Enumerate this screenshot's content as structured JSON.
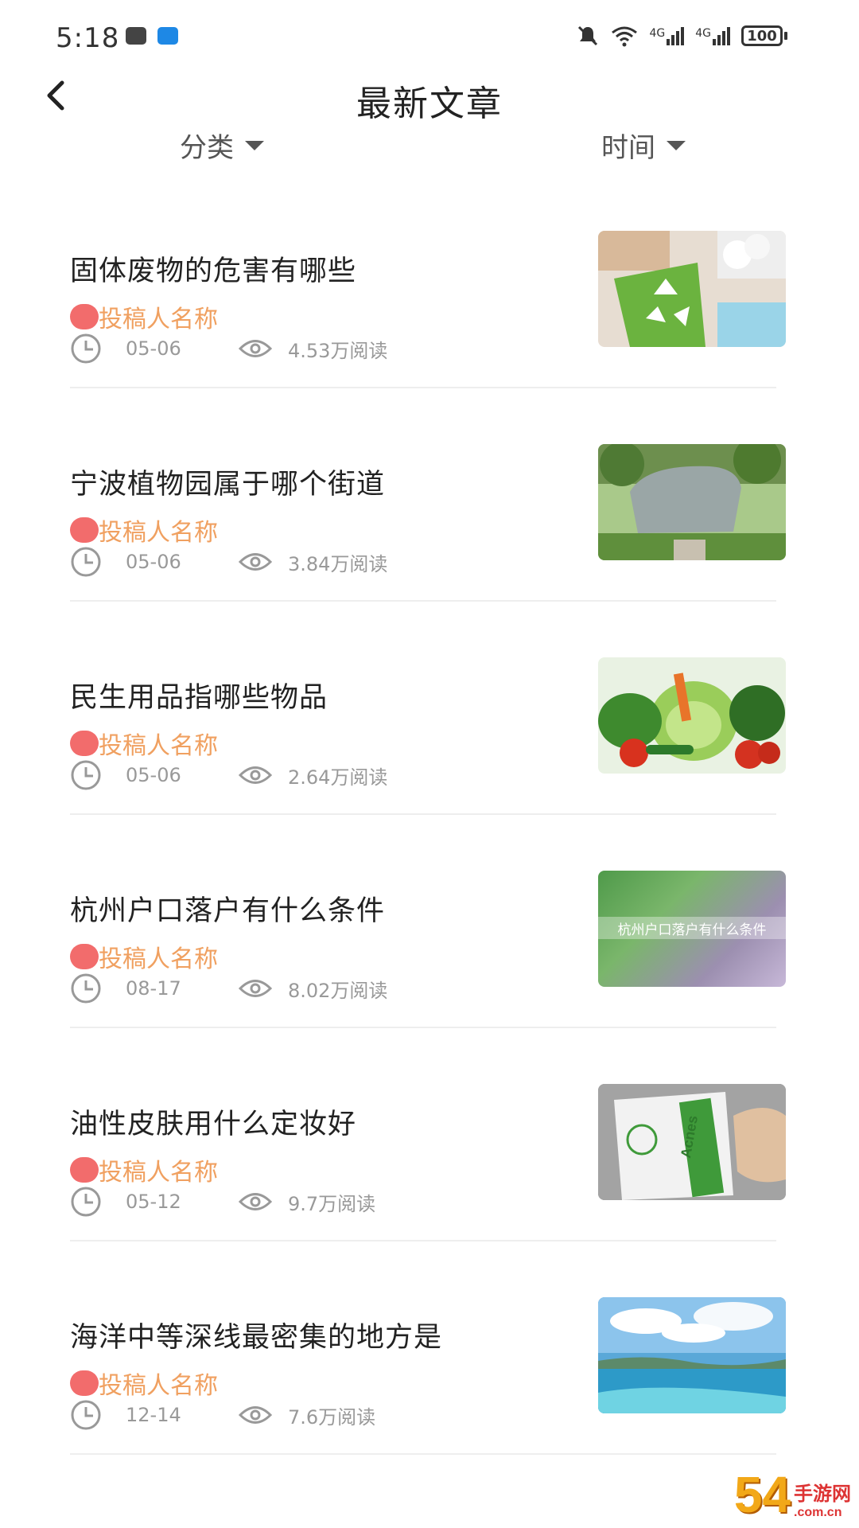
{
  "status_bar": {
    "time": "5:18",
    "signal1": "4G",
    "signal2": "4G",
    "battery": "100"
  },
  "header": {
    "title": "最新文章"
  },
  "filters": {
    "category": "分类",
    "time": "时间"
  },
  "articles": [
    {
      "title": "固体废物的危害有哪些",
      "author": "投稿人名称",
      "date": "05-06",
      "views": "4.53万阅读",
      "thumb": "recycle-bag"
    },
    {
      "title": "宁波植物园属于哪个街道",
      "author": "投稿人名称",
      "date": "05-06",
      "views": "3.84万阅读",
      "thumb": "park-stone"
    },
    {
      "title": "民生用品指哪些物品",
      "author": "投稿人名称",
      "date": "05-06",
      "views": "2.64万阅读",
      "thumb": "vegetables"
    },
    {
      "title": "杭州户口落户有什么条件",
      "author": "投稿人名称",
      "date": "08-17",
      "views": "8.02万阅读",
      "thumb": "text-banner",
      "thumb_text": "杭州户口落户有什么条件"
    },
    {
      "title": "油性皮肤用什么定妆好",
      "author": "投稿人名称",
      "date": "05-12",
      "views": "9.7万阅读",
      "thumb": "product-hand",
      "thumb_text": "Acnes"
    },
    {
      "title": "海洋中等深线最密集的地方是",
      "author": "投稿人名称",
      "date": "12-14",
      "views": "7.6万阅读",
      "thumb": "ocean"
    }
  ],
  "watermark": {
    "main": "54",
    "top": "手游网",
    "bottom": ".com.cn"
  },
  "colors": {
    "author": "#f0a060",
    "author_dot": "#f26c6c",
    "meta": "#999999",
    "divider": "#eeeeee"
  }
}
